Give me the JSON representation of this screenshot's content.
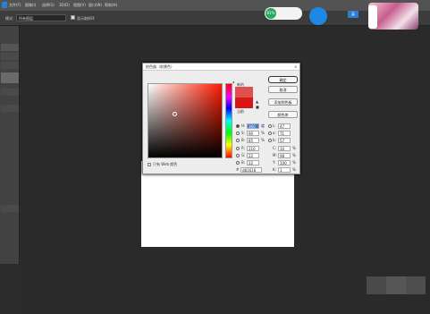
{
  "menu": {
    "items": [
      "文件(F)",
      "图像(I)",
      "选择(S)",
      "3D(D)",
      "视图(V)",
      "窗口(W)",
      "帮助(H)"
    ]
  },
  "options_bar": {
    "mode_label": "模式:",
    "mode_value": "所有图层",
    "sample_label": "显示取样环"
  },
  "overlay": {
    "network_badge": "81%",
    "lang_label": "英"
  },
  "dialog": {
    "title": "拾色器（前景色）",
    "new_label": "新的",
    "current_label": "当前",
    "only_web_label": "只有 Web 颜色",
    "buttons": {
      "ok": "确定",
      "cancel": "取消",
      "add_swatch": "添加到色板",
      "color_library": "颜色库"
    },
    "fields": {
      "H": {
        "label": "H:",
        "value": "360",
        "unit": "度"
      },
      "S": {
        "label": "S:",
        "value": "90",
        "unit": "%"
      },
      "B": {
        "label": "B:",
        "value": "85",
        "unit": "%"
      },
      "R": {
        "label": "R:",
        "value": "216",
        "unit": ""
      },
      "G": {
        "label": "G:",
        "value": "22",
        "unit": ""
      },
      "Bb": {
        "label": "B:",
        "value": "22",
        "unit": ""
      },
      "L": {
        "label": "L:",
        "value": "47",
        "unit": ""
      },
      "a": {
        "label": "a:",
        "value": "71",
        "unit": ""
      },
      "b": {
        "label": "b:",
        "value": "57",
        "unit": ""
      },
      "C": {
        "label": "C:",
        "value": "10",
        "unit": "%"
      },
      "M": {
        "label": "M:",
        "value": "98",
        "unit": "%"
      },
      "Y": {
        "label": "Y:",
        "value": "100",
        "unit": "%"
      },
      "K": {
        "label": "K:",
        "value": "1",
        "unit": "%"
      },
      "hex": {
        "label": "#",
        "value": "d81616"
      }
    },
    "colors": {
      "new_color": "#e05050",
      "current_color": "#d81616"
    }
  }
}
